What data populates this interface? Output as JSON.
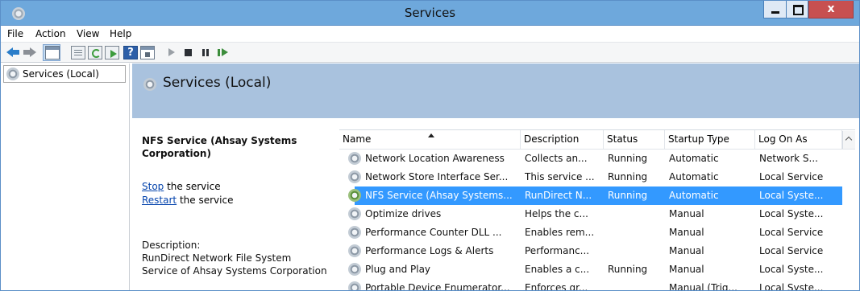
{
  "window": {
    "title": "Services",
    "close_glyph": "x"
  },
  "menu": [
    "File",
    "Action",
    "View",
    "Help"
  ],
  "toolbar": {
    "help_glyph": "?"
  },
  "tree": {
    "root_label": "Services (Local)"
  },
  "pane": {
    "title": "Services (Local)"
  },
  "details": {
    "service_name": "NFS Service (Ahsay Systems Corporation)",
    "stop_link": "Stop",
    "stop_suffix": " the service",
    "restart_link": "Restart",
    "restart_suffix": " the service",
    "description_label": "Description:",
    "description_lines": [
      "RunDirect Network File System",
      "Service of Ahsay Systems Corporation"
    ]
  },
  "list": {
    "columns": [
      "Name",
      "Description",
      "Status",
      "Startup Type",
      "Log On As"
    ],
    "sorted_column": "Name",
    "selected_row": 2,
    "rows": [
      {
        "name": "Network Location Awareness",
        "description": "Collects an...",
        "status": "Running",
        "startup": "Automatic",
        "logon": "Network S..."
      },
      {
        "name": "Network Store Interface Ser...",
        "description": "This service ...",
        "status": "Running",
        "startup": "Automatic",
        "logon": "Local Service"
      },
      {
        "name": "NFS Service (Ahsay Systems...",
        "description": "RunDirect N...",
        "status": "Running",
        "startup": "Automatic",
        "logon": "Local Syste..."
      },
      {
        "name": "Optimize drives",
        "description": "Helps the c...",
        "status": "",
        "startup": "Manual",
        "logon": "Local Syste..."
      },
      {
        "name": "Performance Counter DLL ...",
        "description": "Enables rem...",
        "status": "",
        "startup": "Manual",
        "logon": "Local Service"
      },
      {
        "name": "Performance Logs & Alerts",
        "description": "Performanc...",
        "status": "",
        "startup": "Manual",
        "logon": "Local Service"
      },
      {
        "name": "Plug and Play",
        "description": "Enables a c...",
        "status": "Running",
        "startup": "Manual",
        "logon": "Local Syste..."
      },
      {
        "name": "Portable Device Enumerator...",
        "description": "Enforces gr...",
        "status": "",
        "startup": "Manual (Trig...",
        "logon": "Local Syste..."
      }
    ]
  },
  "colors": {
    "titlebar": "#6ea8dc",
    "pane_header": "#a9c2de",
    "selection": "#3399ff",
    "link": "#0645ad",
    "close_button": "#c75050"
  }
}
